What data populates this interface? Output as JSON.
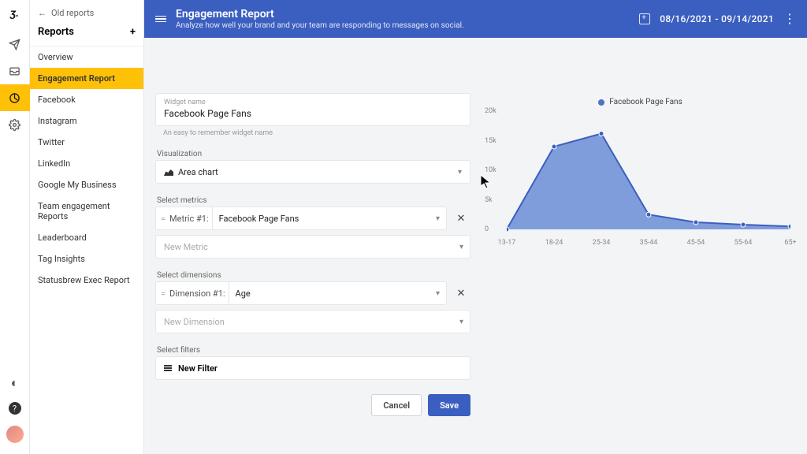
{
  "back_label": "Old reports",
  "reports_heading": "Reports",
  "nav": [
    "Overview",
    "Engagement Report",
    "Facebook",
    "Instagram",
    "Twitter",
    "LinkedIn",
    "Google My Business",
    "Team engagement Reports",
    "Leaderboard",
    "Tag Insights",
    "Statusbrew Exec Report"
  ],
  "nav_active_index": 1,
  "header": {
    "title": "Engagement Report",
    "subtitle": "Analyze how well your brand and your team are responding to messages on social.",
    "date_range": "08/16/2021 - 09/14/2021"
  },
  "form": {
    "widget_name_label": "Widget name",
    "widget_name_value": "Facebook Page Fans",
    "widget_name_helper": "An easy to remember widget name",
    "visualization_label": "Visualization",
    "visualization_value": "Area chart",
    "metrics_label": "Select metrics",
    "metric1_label": "Metric #1:",
    "metric1_value": "Facebook Page Fans",
    "new_metric_placeholder": "New Metric",
    "dimensions_label": "Select dimensions",
    "dimension1_label": "Dimension #1:",
    "dimension1_value": "Age",
    "new_dimension_placeholder": "New Dimension",
    "filters_label": "Select filters",
    "new_filter_label": "New Filter",
    "cancel": "Cancel",
    "save": "Save"
  },
  "chart_data": {
    "type": "area",
    "title": "",
    "legend": "Facebook Page Fans",
    "xlabel": "",
    "ylabel": "",
    "ylim": [
      0,
      20000
    ],
    "yticks": [
      0,
      5000,
      10000,
      15000,
      20000
    ],
    "ytick_labels": [
      "0",
      "5k",
      "10k",
      "15k",
      "20k"
    ],
    "categories": [
      "13-17",
      "18-24",
      "25-34",
      "35-44",
      "45-54",
      "55-64",
      "65+"
    ],
    "values": [
      0,
      14000,
      16200,
      2500,
      1200,
      800,
      500
    ]
  }
}
